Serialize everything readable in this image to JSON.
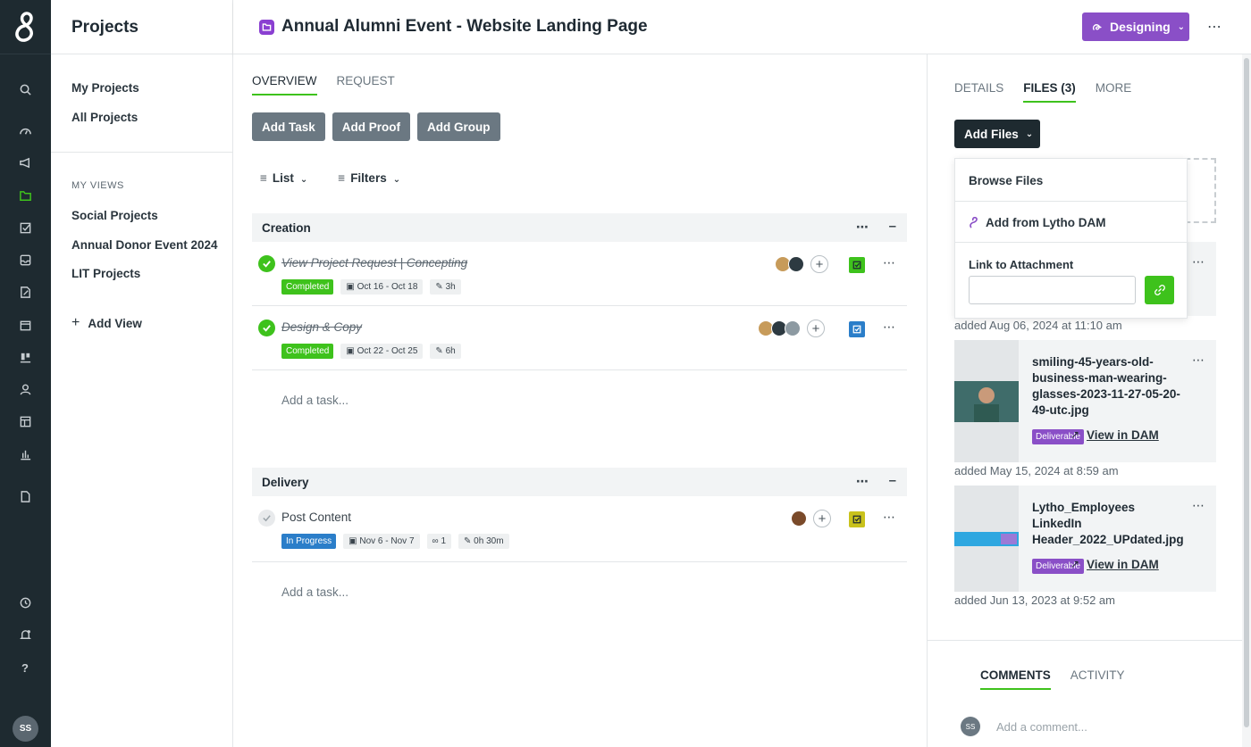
{
  "rail": {
    "avatar_initials": "SS"
  },
  "nav": {
    "title": "Projects",
    "items": [
      {
        "label": "My Projects"
      },
      {
        "label": "All Projects"
      }
    ],
    "views_heading": "MY VIEWS",
    "views": [
      {
        "label": "Social Projects"
      },
      {
        "label": "Annual Donor Event 2024"
      },
      {
        "label": "LIT Projects"
      }
    ],
    "add_view": "Add View"
  },
  "header": {
    "title": "Annual Alumni Event - Website Landing Page",
    "status": "Designing",
    "accent": "#8a4fc7"
  },
  "main": {
    "tabs": [
      {
        "label": "OVERVIEW",
        "active": true
      },
      {
        "label": "REQUEST",
        "active": false
      }
    ],
    "buttons": [
      "Add Task",
      "Add Proof",
      "Add Group"
    ],
    "view_label": "List",
    "filters_label": "Filters",
    "groups": [
      {
        "name": "Creation",
        "tasks": [
          {
            "name": "View Project Request | Concepting",
            "status": "Completed",
            "dates": "Oct 16 - Oct 18",
            "time": "3h"
          },
          {
            "name": "Design & Copy",
            "status": "Completed",
            "dates": "Oct 22 - Oct 25",
            "time": "6h"
          }
        ],
        "add_task": "Add a task..."
      },
      {
        "name": "Delivery",
        "tasks": [
          {
            "name": "Post Content",
            "status": "In Progress",
            "dates": "Nov 6 - Nov 7",
            "links": "1",
            "time": "0h 30m"
          }
        ],
        "add_task": "Add a task..."
      }
    ]
  },
  "right": {
    "tabs": [
      {
        "label": "DETAILS",
        "active": false
      },
      {
        "label": "FILES (3)",
        "active": true
      },
      {
        "label": "MORE",
        "active": false
      }
    ],
    "add_files": "Add Files",
    "dropdown": {
      "browse": "Browse Files",
      "dam": "Add from Lytho DAM",
      "link_label": "Link to Attachment",
      "link_value": ""
    },
    "files": [
      {
        "added": "added Aug 06, 2024 at 11:10 am"
      },
      {
        "name": "smiling-45-years-old-business-man-wearing-glasses-2023-11-27-05-20-49-utc.jpg",
        "tag": "Deliverable",
        "link": "View in DAM",
        "added": "added May 15, 2024 at 8:59 am"
      },
      {
        "name": "Lytho_Employees LinkedIn Header_2022_UPdated.jpg",
        "tag": "Deliverable",
        "link": "View in DAM",
        "added": "added Jun 13, 2023 at 9:52 am"
      }
    ],
    "comment_tabs": [
      {
        "label": "COMMENTS",
        "active": true
      },
      {
        "label": "ACTIVITY",
        "active": false
      }
    ],
    "comment_placeholder": "Add a comment...",
    "comment_avatar": "SS"
  }
}
